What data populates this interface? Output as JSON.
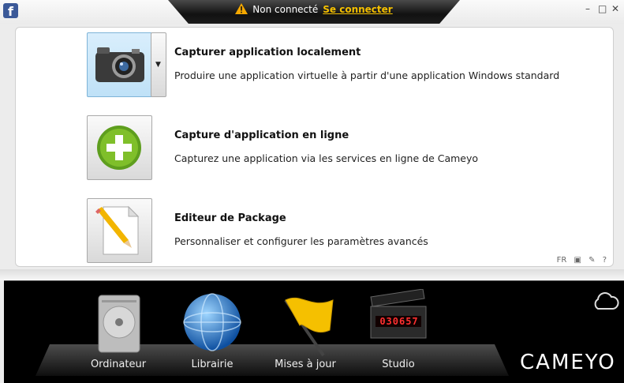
{
  "titlebar": {
    "status_text": "Non connecté",
    "login_link": "Se connecter",
    "minimize": "–",
    "maximize": "□",
    "close": "✕"
  },
  "actions": [
    {
      "title": "Capturer application localement",
      "description": "Produire une application virtuelle à partir d'une application Windows standard",
      "icon": "camera-icon"
    },
    {
      "title": "Capture d'application en ligne",
      "description": "Capturez une application via les services en ligne de Cameyo",
      "icon": "add-icon"
    },
    {
      "title": "Editeur de Package",
      "description": "Personnaliser et configurer les paramètres avancés",
      "icon": "edit-document-icon"
    }
  ],
  "panel_tools": {
    "language": "FR",
    "help": "?"
  },
  "dock": {
    "items": [
      {
        "label": "Ordinateur",
        "icon": "hard-drive-icon"
      },
      {
        "label": "Librairie",
        "icon": "globe-icon"
      },
      {
        "label": "Mises à jour",
        "icon": "flag-icon"
      },
      {
        "label": "Studio",
        "icon": "clapperboard-icon",
        "clock": "030657"
      }
    ],
    "brand": "CAMEYO"
  },
  "colors": {
    "accent": "#f5c000",
    "selected_tile": "#bfe1f7",
    "dock_bg": "#000000"
  }
}
